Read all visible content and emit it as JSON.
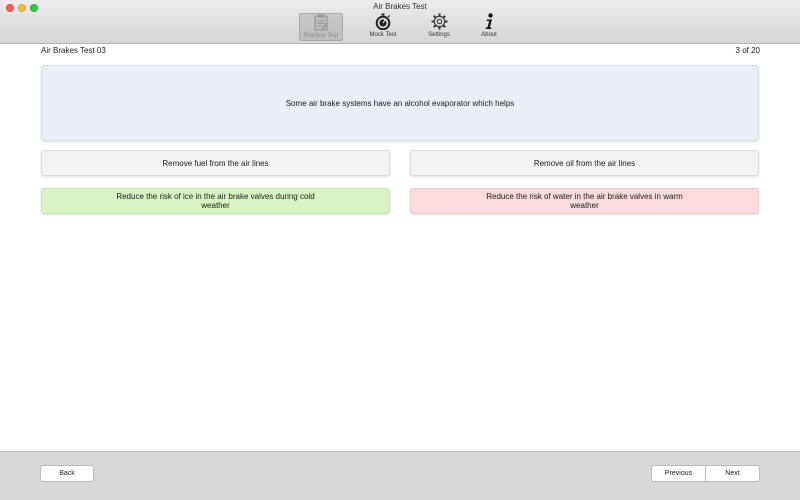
{
  "window": {
    "title": "Air Brakes Test"
  },
  "toolbar": {
    "items": [
      {
        "label": "Practice Test",
        "icon": "clipboard-icon",
        "selected": true
      },
      {
        "label": "Mock Test",
        "icon": "stopwatch-icon",
        "selected": false
      },
      {
        "label": "Settings",
        "icon": "gear-icon",
        "selected": false
      },
      {
        "label": "About",
        "icon": "info-icon",
        "selected": false
      }
    ]
  },
  "header": {
    "test_name": "Air Brakes Test 03",
    "progress": "3 of 20"
  },
  "question": {
    "text": "Some air brake systems have an alcohol evaporator which helps"
  },
  "answers": [
    {
      "text": "Remove fuel from the air lines",
      "state": "neutral"
    },
    {
      "text": "Remove oil from the air lines",
      "state": "neutral"
    },
    {
      "text": "Reduce the risk of ice in the air brake valves during cold weather",
      "state": "correct"
    },
    {
      "text": "Reduce the risk of water in the air brake valves in warm weather",
      "state": "incorrect"
    }
  ],
  "footer": {
    "back_label": "Back",
    "previous_label": "Previous",
    "next_label": "Next"
  },
  "colors": {
    "correct": "#d8f4c4",
    "incorrect": "#fbdcdc",
    "question_bg": "#eaeef6",
    "neutral": "#f4f4f4"
  }
}
